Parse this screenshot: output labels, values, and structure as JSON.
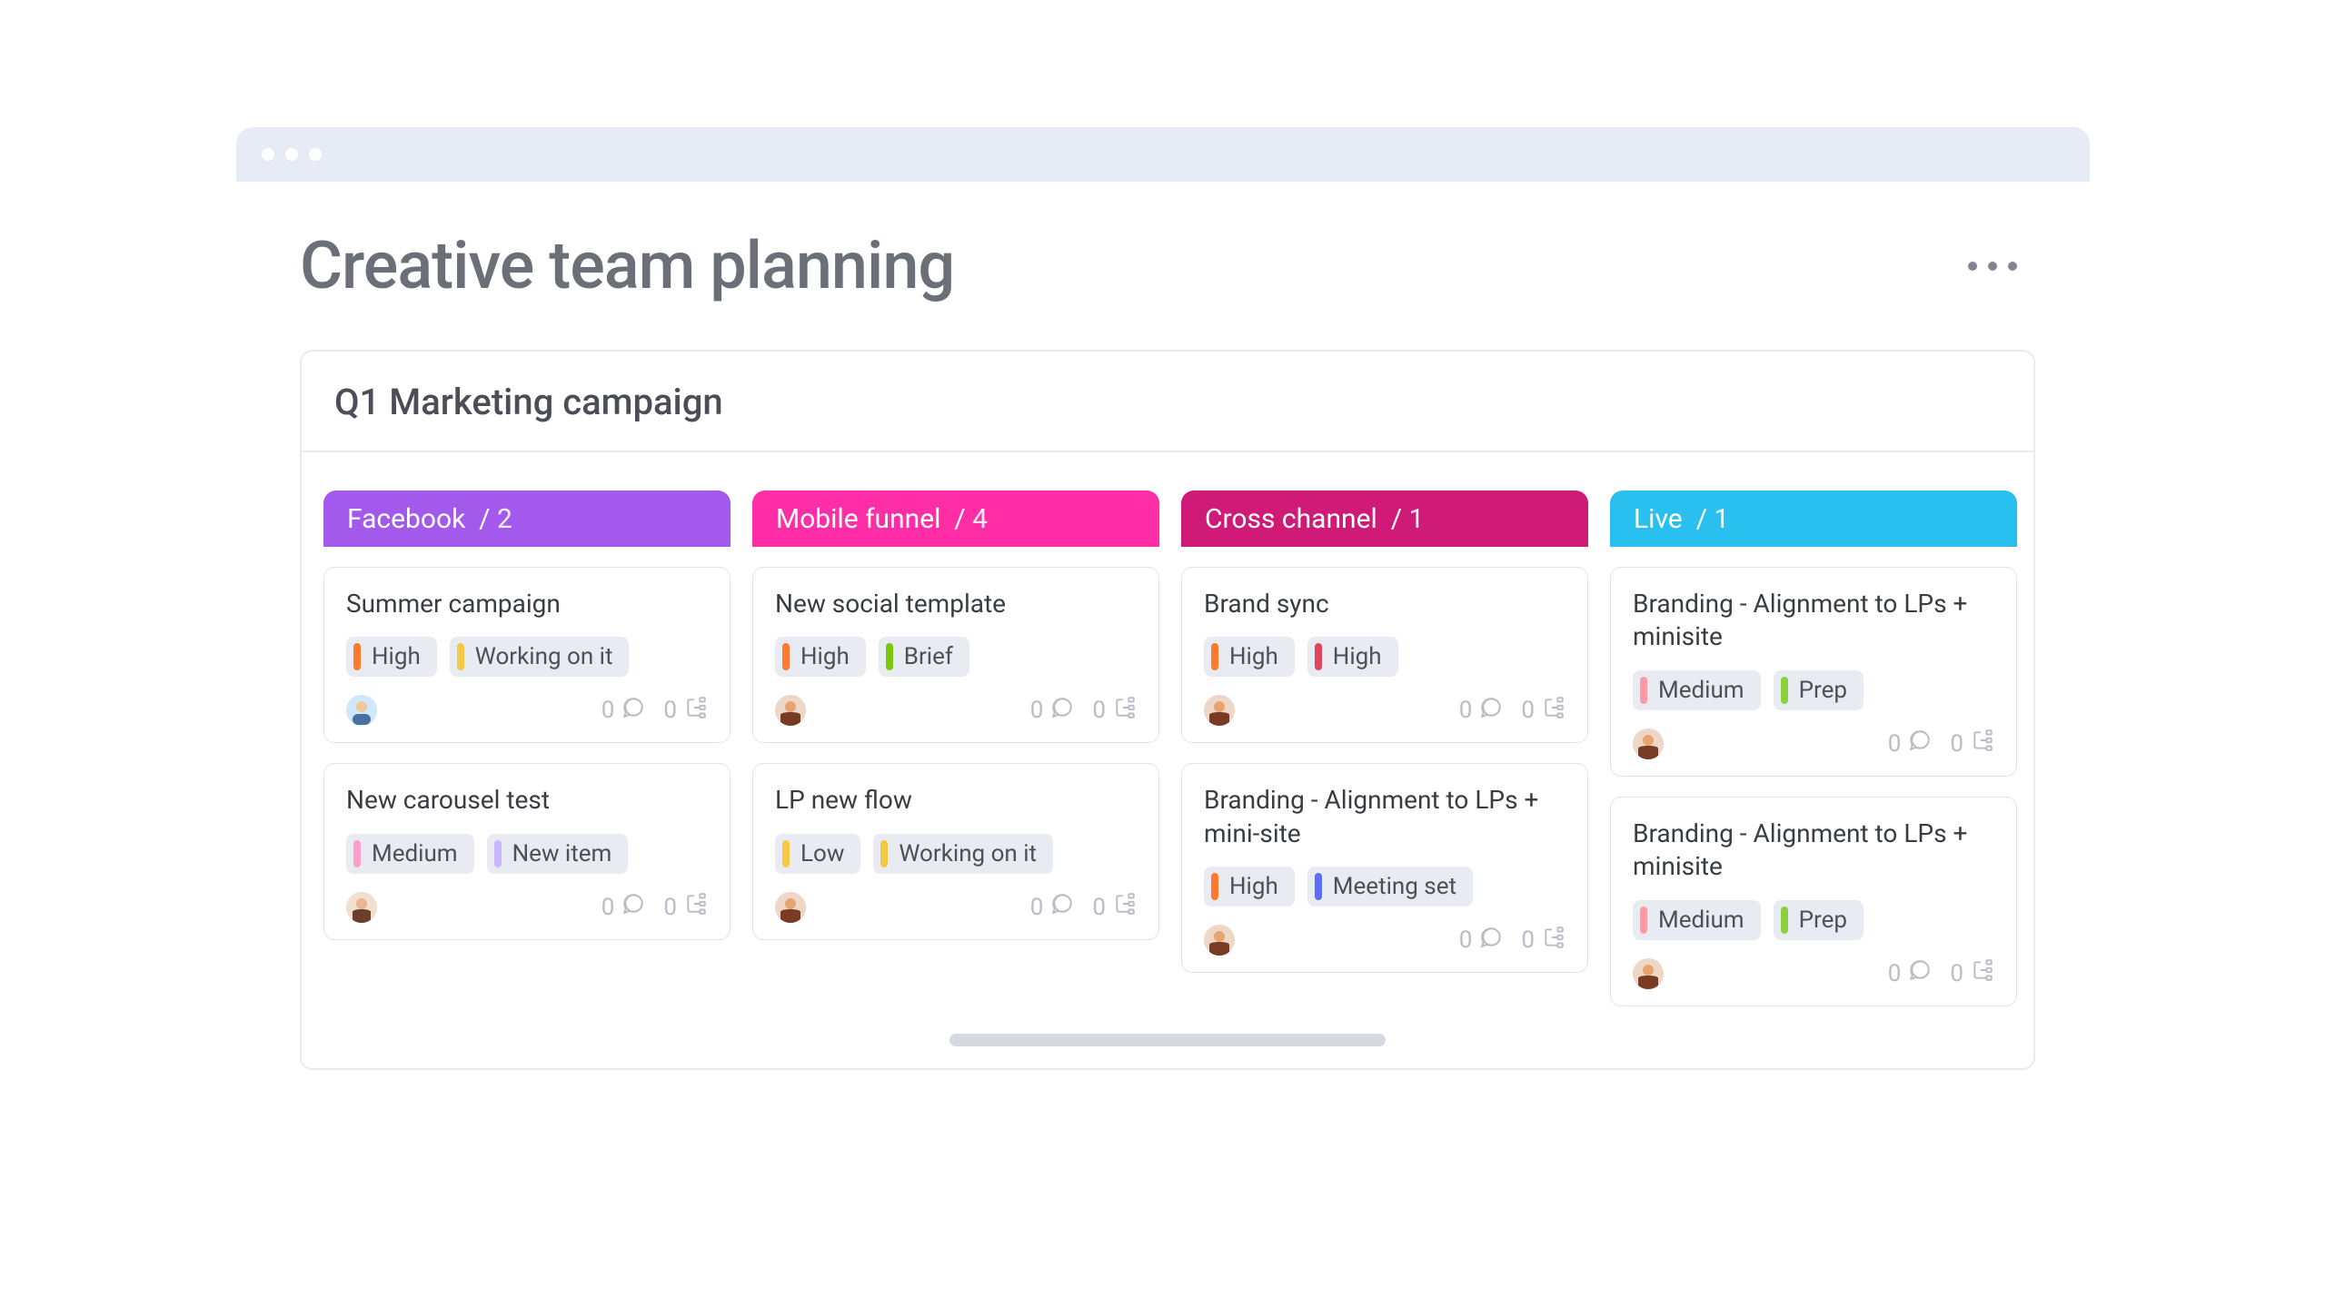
{
  "page": {
    "title": "Creative team planning"
  },
  "board": {
    "title": "Q1 Marketing campaign"
  },
  "colors": {
    "purple": "#a259ec",
    "pink": "#ff2ea6",
    "magenta": "#d01a78",
    "cyan": "#29c0ef",
    "tag_orange": "#ff7a2f",
    "tag_yellow": "#f6c945",
    "tag_green": "#7ac70c",
    "tag_pink": "#ff9ecb",
    "tag_lavender": "#c8b6ff",
    "tag_red": "#e2445c",
    "tag_blue": "#5b6cff",
    "tag_salmon": "#ff9aa2",
    "tag_lime": "#8bd13c"
  },
  "columns": [
    {
      "name": "Facebook",
      "count": 2,
      "color_key": "purple",
      "cards": [
        {
          "title": "Summer campaign",
          "tags": [
            {
              "label": "High",
              "bar_color_key": "tag_orange"
            },
            {
              "label": "Working on it",
              "bar_color_key": "tag_yellow"
            }
          ],
          "avatar": "person1",
          "comments": 0,
          "subitems": 0
        },
        {
          "title": "New carousel test",
          "tags": [
            {
              "label": "Medium",
              "bar_color_key": "tag_pink"
            },
            {
              "label": "New item",
              "bar_color_key": "tag_lavender"
            }
          ],
          "avatar": "person2",
          "comments": 0,
          "subitems": 0
        }
      ]
    },
    {
      "name": "Mobile funnel",
      "count": 4,
      "color_key": "pink",
      "cards": [
        {
          "title": "New social template",
          "tags": [
            {
              "label": "High",
              "bar_color_key": "tag_orange"
            },
            {
              "label": "Brief",
              "bar_color_key": "tag_green"
            }
          ],
          "avatar": "person3",
          "comments": 0,
          "subitems": 0
        },
        {
          "title": "LP new flow",
          "tags": [
            {
              "label": "Low",
              "bar_color_key": "tag_yellow"
            },
            {
              "label": "Working on it",
              "bar_color_key": "tag_yellow"
            }
          ],
          "avatar": "person3",
          "comments": 0,
          "subitems": 0
        }
      ]
    },
    {
      "name": "Cross channel",
      "count": 1,
      "color_key": "magenta",
      "cards": [
        {
          "title": "Brand sync",
          "tags": [
            {
              "label": "High",
              "bar_color_key": "tag_orange"
            },
            {
              "label": "High",
              "bar_color_key": "tag_red"
            }
          ],
          "avatar": "person3",
          "comments": 0,
          "subitems": 0
        },
        {
          "title": "Branding  - Alignment to LPs + mini-site",
          "tags": [
            {
              "label": "High",
              "bar_color_key": "tag_orange"
            },
            {
              "label": "Meeting set",
              "bar_color_key": "tag_blue"
            }
          ],
          "avatar": "person3",
          "comments": 0,
          "subitems": 0
        }
      ]
    },
    {
      "name": "Live",
      "count": 1,
      "color_key": "cyan",
      "cards": [
        {
          "title": "Branding  - Alignment to LPs + minisite",
          "tags": [
            {
              "label": "Medium",
              "bar_color_key": "tag_salmon"
            },
            {
              "label": "Prep",
              "bar_color_key": "tag_lime"
            }
          ],
          "avatar": "person3",
          "comments": 0,
          "subitems": 0
        },
        {
          "title": "Branding  - Alignment to LPs + minisite",
          "tags": [
            {
              "label": "Medium",
              "bar_color_key": "tag_salmon"
            },
            {
              "label": "Prep",
              "bar_color_key": "tag_lime"
            }
          ],
          "avatar": "person3",
          "comments": 0,
          "subitems": 0
        }
      ]
    }
  ]
}
